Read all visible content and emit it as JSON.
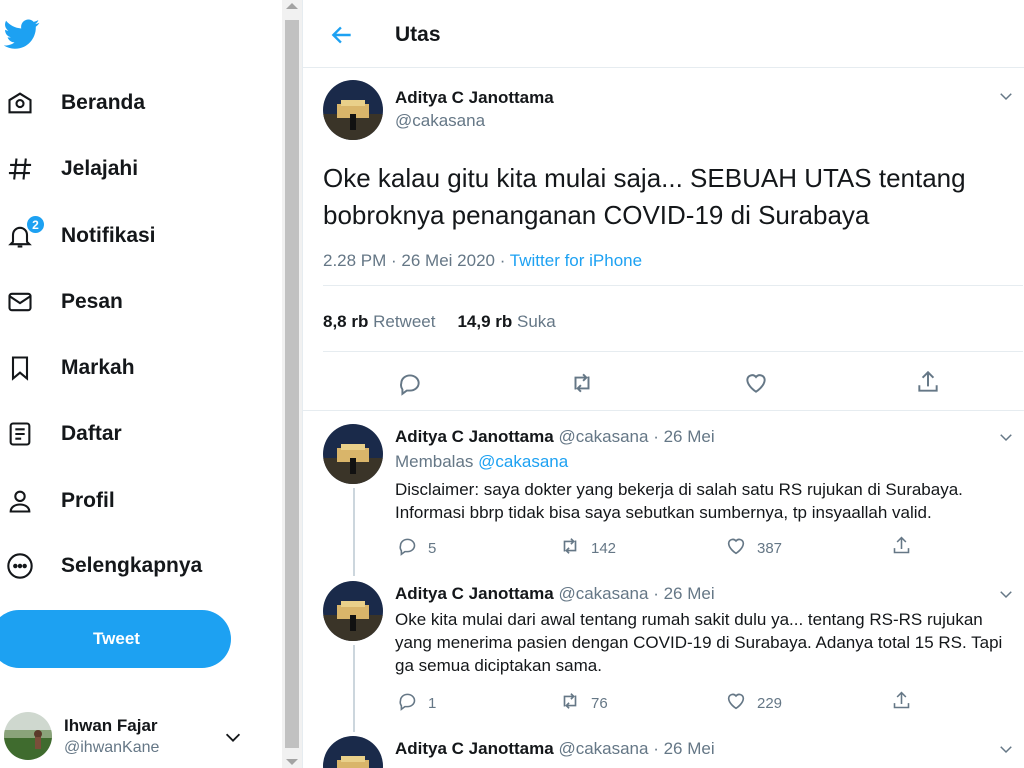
{
  "sidebar": {
    "items": [
      {
        "label": "Beranda",
        "icon": "home-icon"
      },
      {
        "label": "Jelajahi",
        "icon": "hashtag-icon"
      },
      {
        "label": "Notifikasi",
        "icon": "bell-icon",
        "badge": "2"
      },
      {
        "label": "Pesan",
        "icon": "mail-icon"
      },
      {
        "label": "Markah",
        "icon": "bookmark-icon"
      },
      {
        "label": "Daftar",
        "icon": "list-icon"
      },
      {
        "label": "Profil",
        "icon": "person-icon"
      },
      {
        "label": "Selengkapnya",
        "icon": "more-circle-icon"
      }
    ],
    "tweet_button": "Tweet",
    "account": {
      "name": "Ihwan Fajar",
      "handle": "@ihwanKane"
    }
  },
  "header": {
    "title": "Utas"
  },
  "main_tweet": {
    "name": "Aditya C Janottama",
    "handle": "@cakasana",
    "text": "Oke kalau gitu kita mulai saja... SEBUAH UTAS tentang bobroknya penanganan COVID-19 di Surabaya",
    "time": "2.28 PM · 26 Mei 2020 · ",
    "source": "Twitter for iPhone",
    "retweets": "8,8 rb",
    "retweets_label": "Retweet",
    "likes": "14,9 rb",
    "likes_label": "Suka"
  },
  "replies": [
    {
      "name": "Aditya C Janottama",
      "meta": "@cakasana · 26 Mei",
      "replying_prefix": "Membalas",
      "replying_to": "@cakasana",
      "text": "Disclaimer: saya dokter yang bekerja di salah satu RS rujukan di Surabaya. Informasi bbrp tidak bisa saya sebutkan sumbernya, tp insyaallah valid.",
      "replies": "5",
      "retweets": "142",
      "likes": "387"
    },
    {
      "name": "Aditya C Janottama",
      "meta": "@cakasana · 26 Mei",
      "text": "Oke kita mulai dari awal tentang rumah sakit dulu ya... tentang RS-RS rujukan yang menerima pasien dengan COVID-19 di Surabaya. Adanya total 15 RS. Tapi ga semua diciptakan sama.",
      "replies": "1",
      "retweets": "76",
      "likes": "229"
    },
    {
      "name": "Aditya C Janottama",
      "meta": "@cakasana · 26 Mei"
    }
  ],
  "colors": {
    "accent": "#1da1f2",
    "text": "#14171a",
    "muted": "#657786",
    "border": "#e6ecf0"
  }
}
